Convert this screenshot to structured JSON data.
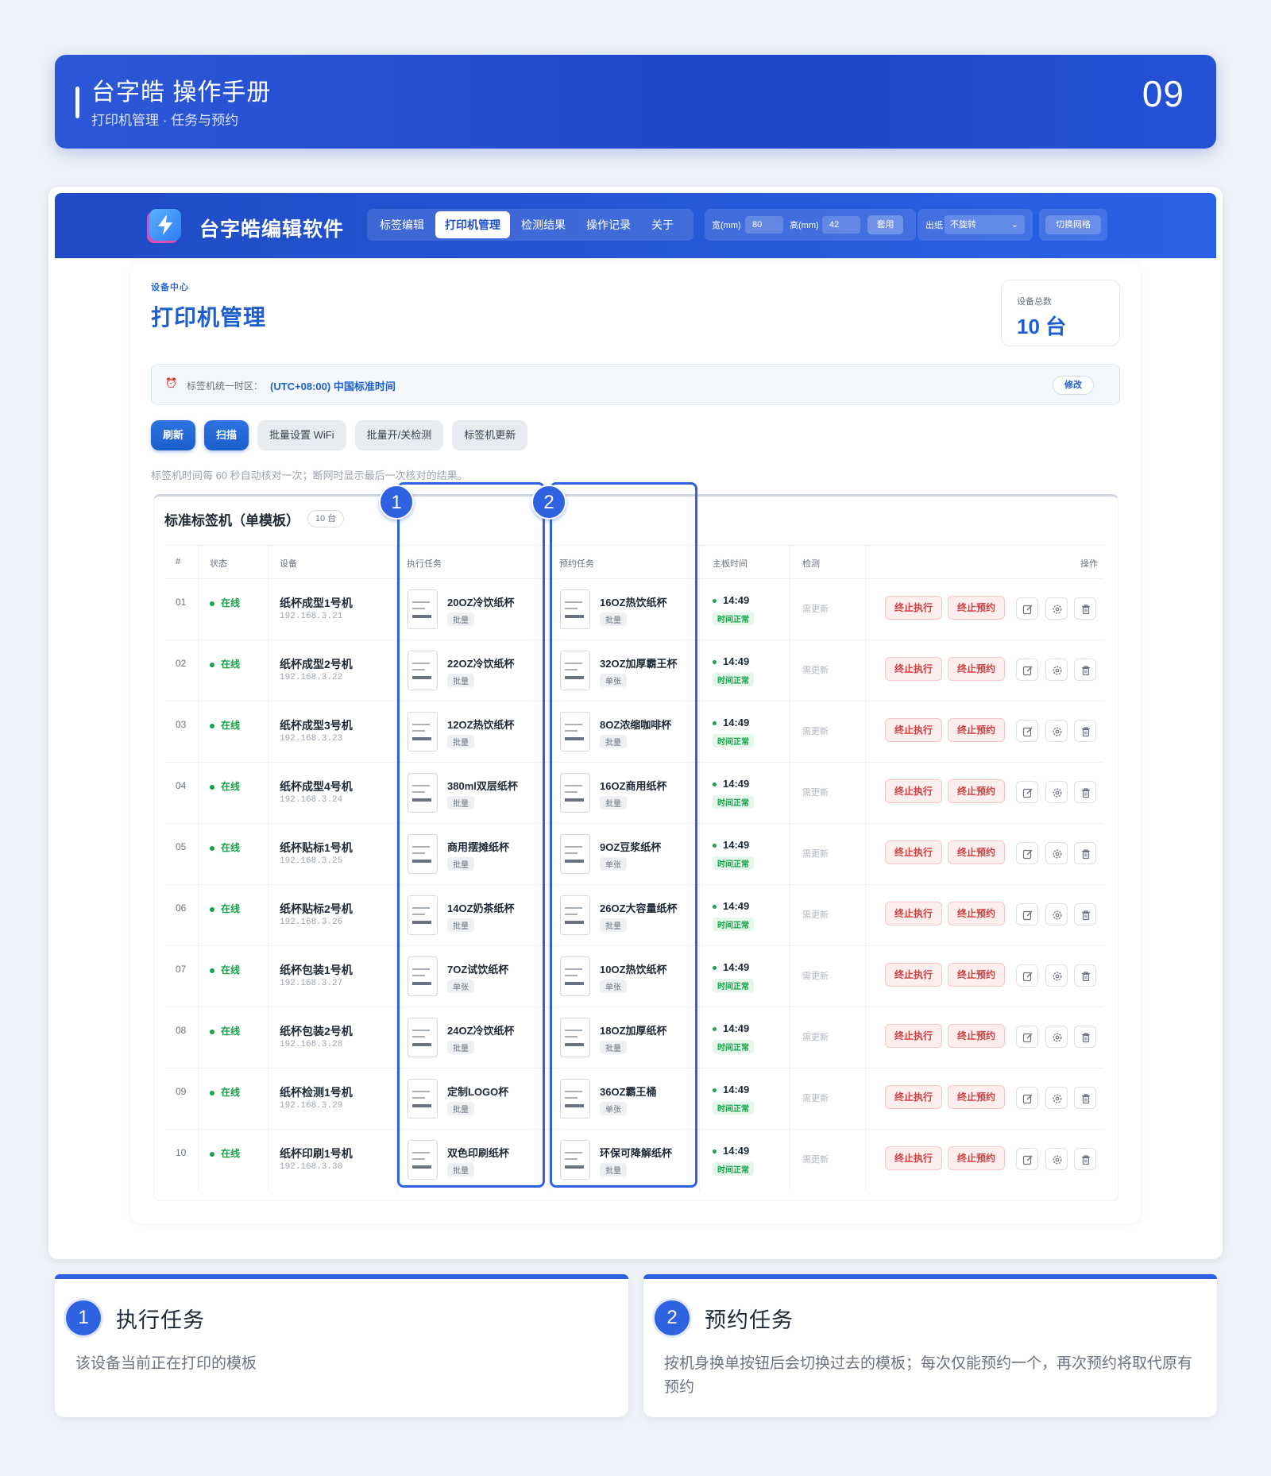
{
  "header": {
    "title": "台字皓 操作手册",
    "subtitle": "打印机管理 · 任务与预约",
    "page_number": "09"
  },
  "app": {
    "name": "台字皓编辑软件",
    "nav": [
      "标签编辑",
      "打印机管理",
      "检测结果",
      "操作记录",
      "关于"
    ],
    "active_nav": "打印机管理",
    "width_label": "宽(mm)",
    "width_value": "80",
    "height_label": "高(mm)",
    "height_value": "42",
    "apply_label": "套用",
    "out_label": "出纸",
    "out_value": "不旋转",
    "grid_label": "切换网格"
  },
  "page": {
    "eyebrow": "设备中心",
    "title": "打印机管理",
    "count_label": "设备总数",
    "count_value": "10 台",
    "tz_label": "标签机统一时区：",
    "tz_value": "(UTC+08:00) 中国标准时间",
    "tz_edit": "修改",
    "buttons": [
      "刷新",
      "扫描",
      "批量设置 WiFi",
      "批量开/关检测",
      "标签机更新"
    ],
    "hint": "标签机时间每 60 秒自动核对一次；断网时显示最后一次核对的结果。"
  },
  "table": {
    "name": "标准标签机（单模板）",
    "count": "10 台",
    "headers": [
      "#",
      "状态",
      "设备",
      "执行任务",
      "预约任务",
      "主板时间",
      "检测",
      "操作"
    ],
    "stop_exec": "终止执行",
    "stop_resv": "终止预约",
    "need_update": "需更新",
    "time_ok": "时间正常",
    "rows": [
      {
        "no": "01",
        "status": "在线",
        "device": "纸杯成型1号机",
        "ip": "192.168.3.21",
        "exec": "20OZ冷饮纸杯",
        "exec_mode": "批量",
        "resv": "16OZ热饮纸杯",
        "resv_mode": "批量",
        "time": "14:49"
      },
      {
        "no": "02",
        "status": "在线",
        "device": "纸杯成型2号机",
        "ip": "192.168.3.22",
        "exec": "22OZ冷饮纸杯",
        "exec_mode": "批量",
        "resv": "32OZ加厚霸王杯",
        "resv_mode": "单张",
        "time": "14:49"
      },
      {
        "no": "03",
        "status": "在线",
        "device": "纸杯成型3号机",
        "ip": "192.168.3.23",
        "exec": "12OZ热饮纸杯",
        "exec_mode": "批量",
        "resv": "8OZ浓缩咖啡杯",
        "resv_mode": "批量",
        "time": "14:49"
      },
      {
        "no": "04",
        "status": "在线",
        "device": "纸杯成型4号机",
        "ip": "192.168.3.24",
        "exec": "380ml双层纸杯",
        "exec_mode": "批量",
        "resv": "16OZ商用纸杯",
        "resv_mode": "批量",
        "time": "14:49"
      },
      {
        "no": "05",
        "status": "在线",
        "device": "纸杯贴标1号机",
        "ip": "192.168.3.25",
        "exec": "商用摆摊纸杯",
        "exec_mode": "批量",
        "resv": "9OZ豆浆纸杯",
        "resv_mode": "单张",
        "time": "14:49"
      },
      {
        "no": "06",
        "status": "在线",
        "device": "纸杯贴标2号机",
        "ip": "192.168.3.26",
        "exec": "14OZ奶茶纸杯",
        "exec_mode": "批量",
        "resv": "26OZ大容量纸杯",
        "resv_mode": "批量",
        "time": "14:49"
      },
      {
        "no": "07",
        "status": "在线",
        "device": "纸杯包装1号机",
        "ip": "192.168.3.27",
        "exec": "7OZ试饮纸杯",
        "exec_mode": "单张",
        "resv": "10OZ热饮纸杯",
        "resv_mode": "单张",
        "time": "14:49"
      },
      {
        "no": "08",
        "status": "在线",
        "device": "纸杯包装2号机",
        "ip": "192.168.3.28",
        "exec": "24OZ冷饮纸杯",
        "exec_mode": "批量",
        "resv": "18OZ加厚纸杯",
        "resv_mode": "批量",
        "time": "14:49"
      },
      {
        "no": "09",
        "status": "在线",
        "device": "纸杯检测1号机",
        "ip": "192.168.3.29",
        "exec": "定制LOGO杯",
        "exec_mode": "批量",
        "resv": "36OZ霸王桶",
        "resv_mode": "单张",
        "time": "14:49"
      },
      {
        "no": "10",
        "status": "在线",
        "device": "纸杯印刷1号机",
        "ip": "192.168.3.30",
        "exec": "双色印刷纸杯",
        "exec_mode": "批量",
        "resv": "环保可降解纸杯",
        "resv_mode": "批量",
        "time": "14:49"
      }
    ]
  },
  "callouts": [
    {
      "num": "1",
      "title": "执行任务",
      "desc": "该设备当前正在打印的模板"
    },
    {
      "num": "2",
      "title": "预约任务",
      "desc": "按机身换单按钮后会切换过去的模板；每次仅能预约一个，再次预约将取代原有预约"
    }
  ],
  "colors": {
    "brand": "#1e5fd0",
    "highlight": "#2e62e0",
    "online": "#16a34a",
    "danger": "#d33c3c"
  },
  "icons": [
    "lightning-logo-icon",
    "alarm-clock-icon",
    "edit-icon",
    "gear-icon",
    "trash-icon"
  ]
}
